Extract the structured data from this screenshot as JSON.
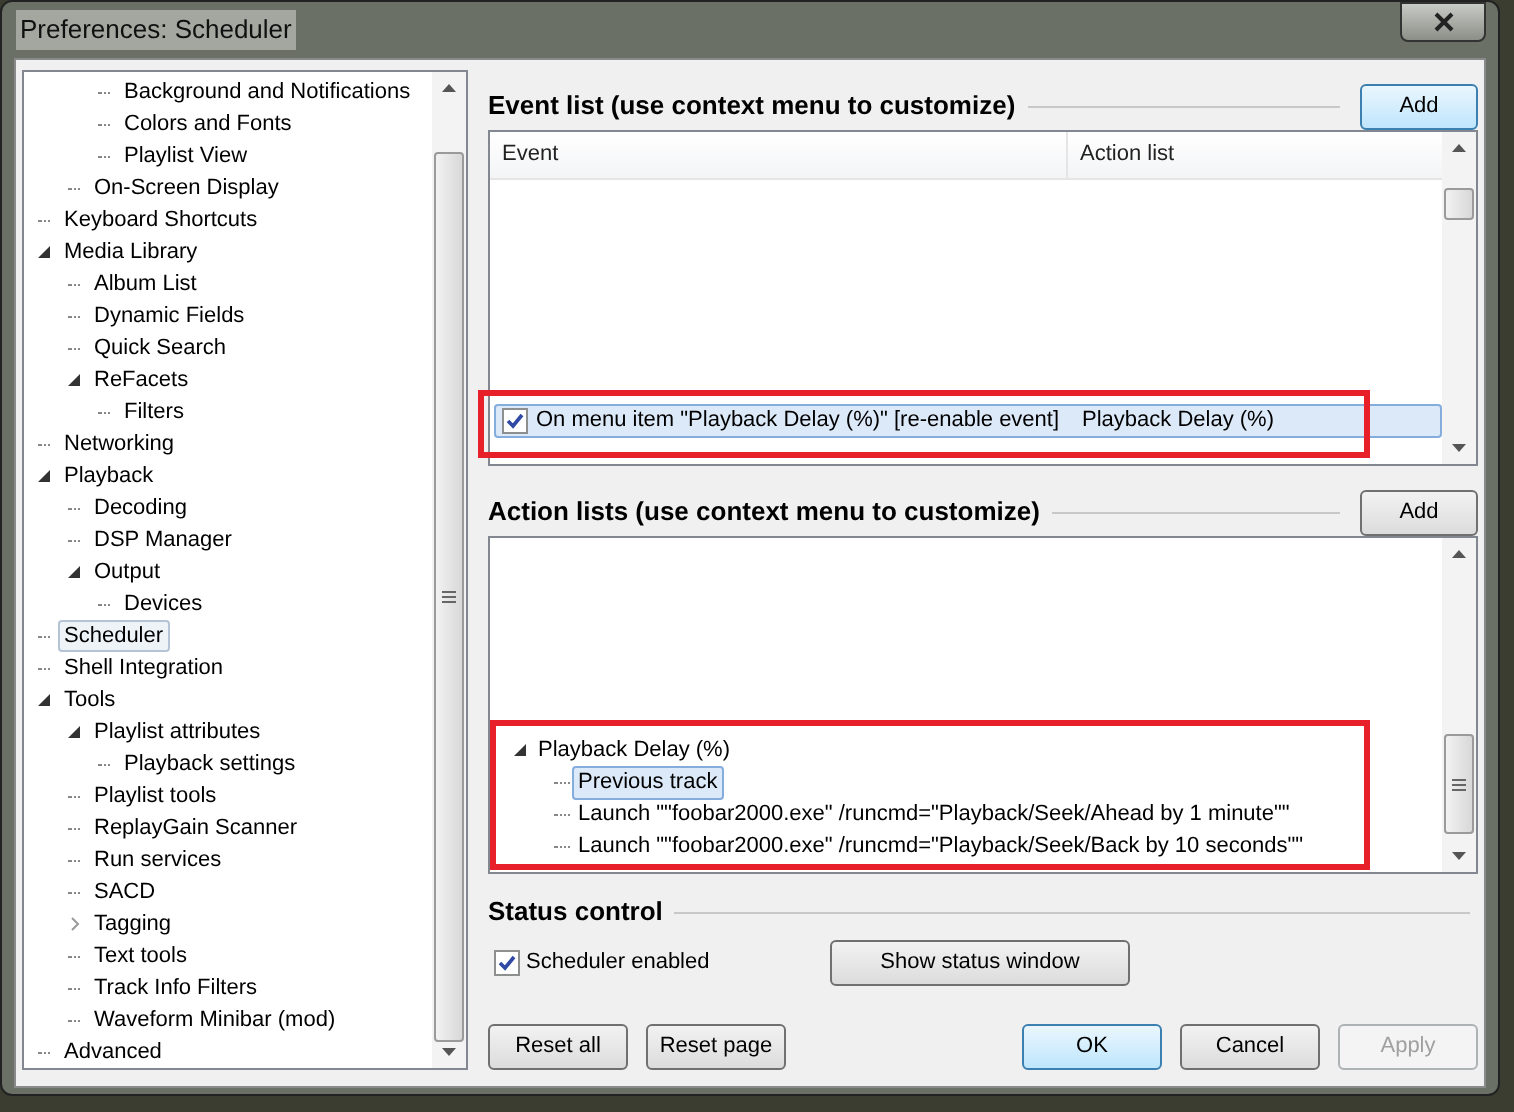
{
  "window": {
    "title": "Preferences: Scheduler"
  },
  "tree": [
    {
      "children": [
        {
          "children": [
            {
              "label": "Background and Notifications",
              "selected": false
            },
            {
              "label": "Colors and Fonts",
              "selected": false
            },
            {
              "label": "Playlist View",
              "selected": false
            }
          ]
        },
        {
          "label": "On-Screen Display",
          "selected": false
        }
      ]
    },
    {
      "label": "Keyboard Shortcuts",
      "selected": false
    },
    {
      "label": "Media Library",
      "selected": false,
      "expanded": true,
      "children": [
        {
          "label": "Album List",
          "selected": false
        },
        {
          "label": "Dynamic Fields",
          "selected": false
        },
        {
          "label": "Quick Search",
          "selected": false
        },
        {
          "label": "ReFacets",
          "selected": false,
          "expanded": true,
          "children": [
            {
              "label": "Filters",
              "selected": false
            }
          ]
        }
      ]
    },
    {
      "label": "Networking",
      "selected": false
    },
    {
      "label": "Playback",
      "selected": false,
      "expanded": true,
      "children": [
        {
          "label": "Decoding",
          "selected": false
        },
        {
          "label": "DSP Manager",
          "selected": false
        },
        {
          "label": "Output",
          "selected": false,
          "expanded": true,
          "children": [
            {
              "label": "Devices",
              "selected": false
            }
          ]
        }
      ]
    },
    {
      "label": "Scheduler",
      "selected": true
    },
    {
      "label": "Shell Integration",
      "selected": false
    },
    {
      "label": "Tools",
      "selected": false,
      "expanded": true,
      "children": [
        {
          "label": "Playlist attributes",
          "selected": false,
          "expanded": true,
          "children": [
            {
              "label": "Playback settings",
              "selected": false
            }
          ]
        },
        {
          "label": "Playlist tools",
          "selected": false
        },
        {
          "label": "ReplayGain Scanner",
          "selected": false
        },
        {
          "label": "Run services",
          "selected": false
        },
        {
          "label": "SACD",
          "selected": false
        },
        {
          "label": "Tagging",
          "selected": false,
          "expanded": false
        },
        {
          "label": "Text tools",
          "selected": false
        },
        {
          "label": "Track Info Filters",
          "selected": false
        },
        {
          "label": "Waveform Minibar (mod)",
          "selected": false
        }
      ]
    },
    {
      "label": "Advanced",
      "selected": false
    }
  ],
  "event_list": {
    "heading": "Event list (use context menu to customize)",
    "add_button": "Add",
    "columns": [
      "Event",
      "Action list"
    ],
    "rows": [
      {
        "event": "On menu item \"Playback Delay (%)\" [re-enable event]",
        "action_list": "Playback Delay (%)",
        "checked": true,
        "selected": true
      }
    ]
  },
  "action_lists": {
    "heading": "Action lists (use context menu to customize)",
    "add_button": "Add",
    "items": [
      {
        "label": "Playback Delay (%)",
        "expanded": true,
        "selected": false,
        "children": [
          {
            "label": "Previous track",
            "selected": true
          },
          {
            "label": "Launch \"\"foobar2000.exe\" /runcmd=\"Playback/Seek/Ahead by 1 minute\"\"",
            "selected": false
          },
          {
            "label": "Launch \"\"foobar2000.exe\" /runcmd=\"Playback/Seek/Back by 10 seconds\"\"",
            "selected": false
          }
        ]
      }
    ]
  },
  "status_control": {
    "heading": "Status control",
    "checkbox": {
      "label": "Scheduler enabled",
      "checked": true
    },
    "button": "Show status window"
  },
  "buttons": [
    {
      "label": "Reset all",
      "kind": "left",
      "disabled": false,
      "default": false
    },
    {
      "label": "Reset page",
      "kind": "left",
      "disabled": false,
      "default": false
    },
    {
      "label": "OK",
      "kind": "right",
      "disabled": false,
      "default": true
    },
    {
      "label": "Cancel",
      "kind": "right",
      "disabled": false,
      "default": false
    },
    {
      "label": "Apply",
      "kind": "right",
      "disabled": true,
      "default": false
    }
  ]
}
